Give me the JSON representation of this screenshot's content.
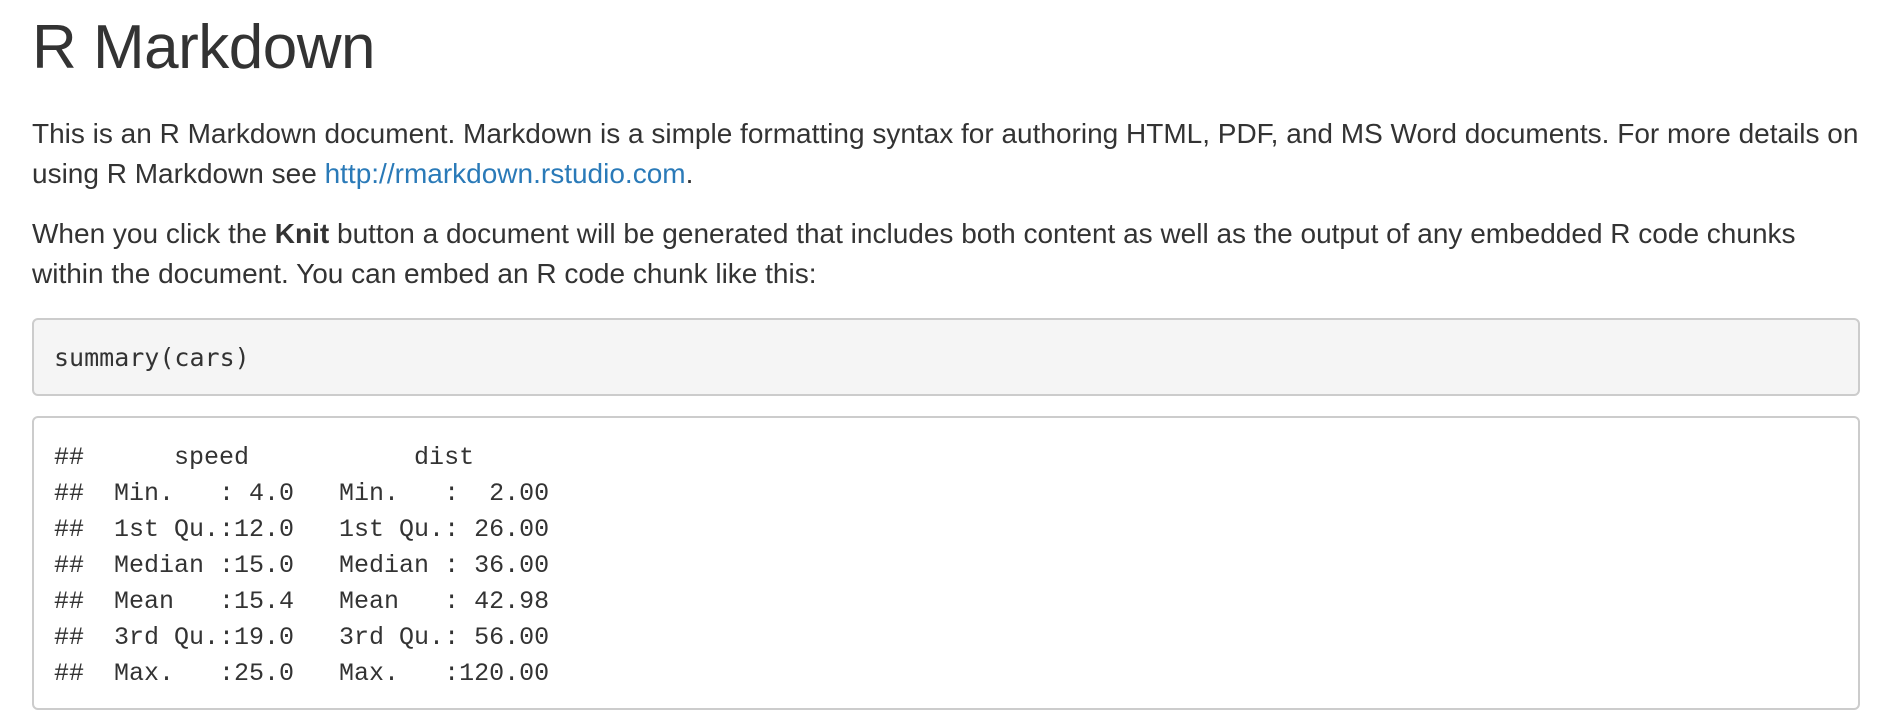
{
  "heading": "R Markdown",
  "paragraph1": {
    "text_before_link": "This is an R Markdown document. Markdown is a simple formatting syntax for authoring HTML, PDF, and MS Word documents. For more details on using R Markdown see ",
    "link_text": "http://rmarkdown.rstudio.com",
    "text_after_link": "."
  },
  "paragraph2": {
    "text_before_bold": "When you click the ",
    "bold_text": "Knit",
    "text_after_bold": " button a document will be generated that includes both content as well as the output of any embedded R code chunks within the document. You can embed an R code chunk like this:"
  },
  "code_chunk": "summary(cars)",
  "output_lines": [
    "##      speed           dist       ",
    "##  Min.   : 4.0   Min.   :  2.00  ",
    "##  1st Qu.:12.0   1st Qu.: 26.00  ",
    "##  Median :15.0   Median : 36.00  ",
    "##  Mean   :15.4   Mean   : 42.98  ",
    "##  3rd Qu.:19.0   3rd Qu.: 56.00  ",
    "##  Max.   :25.0   Max.   :120.00  "
  ],
  "colors": {
    "text": "#333333",
    "link": "#2a7ab8",
    "code_background": "#f5f5f5",
    "border": "#cccccc"
  }
}
